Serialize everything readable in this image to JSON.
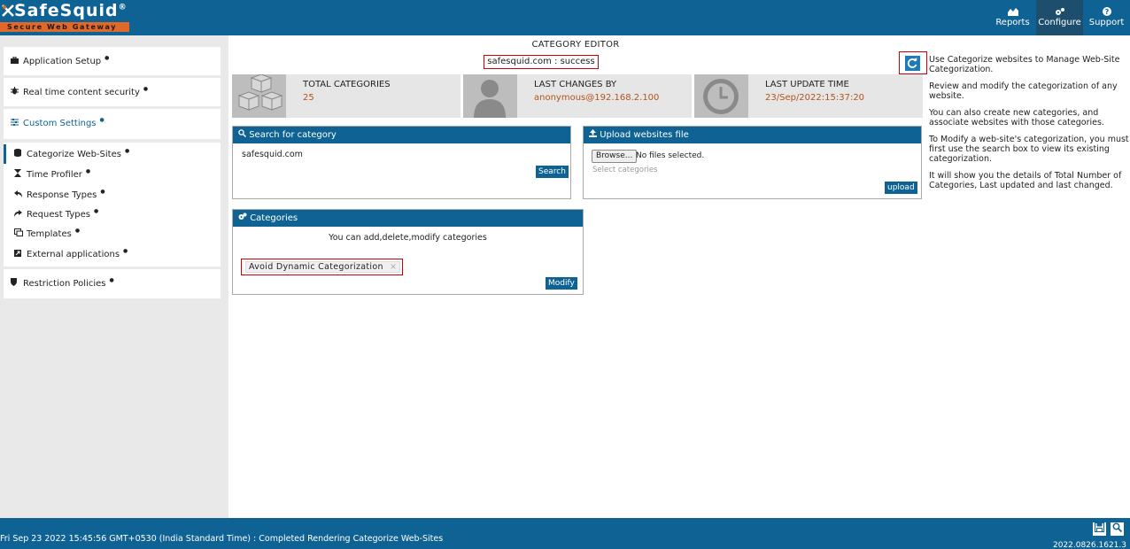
{
  "header": {
    "brand": "SafeSquid",
    "registered": "®",
    "tagline": "Secure Web Gateway",
    "nav": [
      {
        "label": "Reports",
        "icon": "reports-icon"
      },
      {
        "label": "Configure",
        "icon": "configure-icon"
      },
      {
        "label": "Support",
        "icon": "support-icon"
      }
    ],
    "active_nav": "Configure"
  },
  "sidebar": {
    "top_items": [
      {
        "label": "Application Setup",
        "icon": "briefcase-icon"
      },
      {
        "label": "Real time content security",
        "icon": "bug-icon"
      },
      {
        "label": "Custom Settings",
        "icon": "sliders-icon"
      }
    ],
    "sub_items": [
      {
        "label": "Categorize Web-Sites",
        "icon": "database-icon"
      },
      {
        "label": "Time Profiler",
        "icon": "hourglass-icon"
      },
      {
        "label": "Response Types",
        "icon": "reply-icon"
      },
      {
        "label": "Request Types",
        "icon": "share-icon"
      },
      {
        "label": "Templates",
        "icon": "templates-icon"
      },
      {
        "label": "External applications",
        "icon": "external-icon"
      }
    ],
    "bottom_item": {
      "label": "Restriction Policies",
      "icon": "shield-icon"
    }
  },
  "main": {
    "title": "CATEGORY EDITOR",
    "status": "safesquid.com : success",
    "stats": [
      {
        "label": "TOTAL CATEGORIES",
        "value": "25",
        "icon": "cubes-icon"
      },
      {
        "label": "LAST CHANGES BY",
        "value": "anonymous@192.168.2.100",
        "icon": "user-icon"
      },
      {
        "label": "LAST UPDATE TIME",
        "value": "23/Sep/2022:15:37:20",
        "icon": "clock-icon"
      }
    ],
    "search_panel": {
      "title": "Search for category",
      "value": "safesquid.com",
      "button": "Search"
    },
    "upload_panel": {
      "title": "Upload websites file",
      "browse": "Browse...",
      "file_status": "No files selected.",
      "placeholder": "Select categories",
      "button": "upload"
    },
    "categories_panel": {
      "title": "Categories",
      "description": "You can add,delete,modify categories",
      "tag": "Avoid Dynamic Categorization",
      "tag_remove": "×",
      "button": "Modify"
    }
  },
  "help": {
    "paragraphs": [
      "Use Categorize websites to Manage Web-Site Categorization.",
      "Review and modify the categorization of any website.",
      "You can also create new categories, and associate websites with those categories.",
      "To Modify a web-site's categorization, you must first use the search box to view its existing categorization.",
      "It will show you the details of Total Number of Categories, Last updated and last changed."
    ]
  },
  "footer": {
    "message": "Fri Sep 23 2022 15:45:56 GMT+0530 (India Standard Time) : Completed Rendering Categorize Web-Sites",
    "version": "2022.0826.1621.3"
  }
}
